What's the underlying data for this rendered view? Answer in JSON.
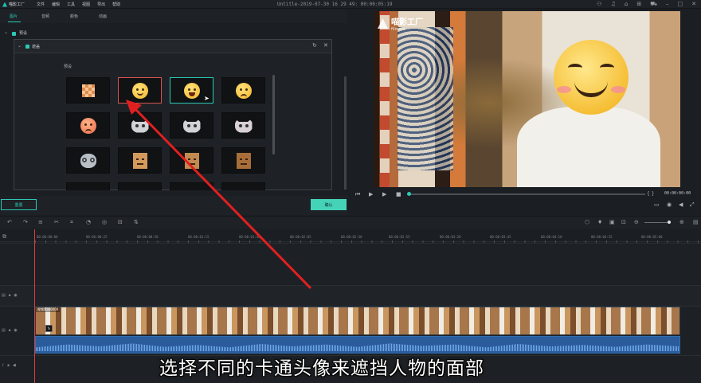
{
  "app": {
    "logo_text": "喵影工厂",
    "menu": [
      "文件",
      "编辑",
      "工具",
      "视图",
      "导出",
      "帮助"
    ],
    "doc_title": "Untitle-2019-07-30 16 29 49: 00:00:05:19"
  },
  "panel": {
    "tabs": [
      "图片",
      "音频",
      "颜色",
      "动画"
    ],
    "preset_root_label": "预设",
    "mosaic_label": "遮盖",
    "grid_label": "预设",
    "reset_label": "重置",
    "ok_label": "确认"
  },
  "preview": {
    "watermark_title": "喵影工厂",
    "watermark_sub": "filmora",
    "timecode": "00:00:00:00"
  },
  "timeline": {
    "ruler_labels": [
      "00:00:00:00",
      "00:00:00:25",
      "00:00:00:50",
      "00:00:01:15",
      "00:00:01:40",
      "00:00:02:05",
      "00:00:02:30",
      "00:00:02:55",
      "00:00:03:20",
      "00:00:03:45",
      "00:00:04:10",
      "00:00:04:35",
      "00:00:05:00"
    ],
    "clip_name": "视频素材0000",
    "fx_badge": "fx"
  },
  "subtitle": "选择不同的卡通头像来遮挡人物的面部",
  "colors": {
    "accent": "#2cc9b5",
    "selection_red": "#d9534f",
    "arrow": "#e02020"
  }
}
